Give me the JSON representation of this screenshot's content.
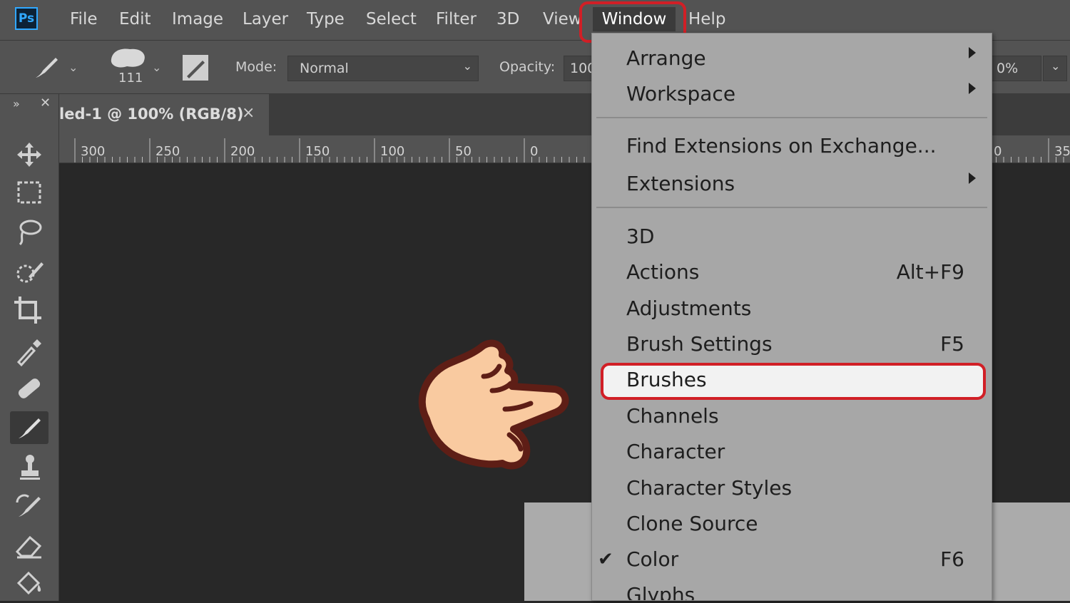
{
  "app": {
    "logo_text": "Ps"
  },
  "menubar": {
    "items": [
      "File",
      "Edit",
      "Image",
      "Layer",
      "Type",
      "Select",
      "Filter",
      "3D",
      "View",
      "Window",
      "Help"
    ]
  },
  "options": {
    "brush_size": "111",
    "mode_label": "Mode:",
    "mode_value": "Normal",
    "opacity_label": "Opacity:",
    "opacity_value": "100",
    "flow_value": "0%"
  },
  "document": {
    "tab_title": "led-1 @ 100% (RGB/8)",
    "tab_close": "×"
  },
  "ruler": {
    "labels": [
      "300",
      "250",
      "200",
      "150",
      "100",
      "50",
      "0",
      "0",
      "35"
    ]
  },
  "window_menu": {
    "items": [
      {
        "label": "Arrange",
        "shortcut": "",
        "submenu": true
      },
      {
        "label": "Workspace",
        "shortcut": "",
        "submenu": true
      },
      {
        "label": "Find Extensions on Exchange...",
        "shortcut": "",
        "submenu": false
      },
      {
        "label": "Extensions",
        "shortcut": "",
        "submenu": true
      },
      {
        "label": "3D",
        "shortcut": ""
      },
      {
        "label": "Actions",
        "shortcut": "Alt+F9"
      },
      {
        "label": "Adjustments",
        "shortcut": ""
      },
      {
        "label": "Brush Settings",
        "shortcut": "F5"
      },
      {
        "label": "Brushes",
        "shortcut": "",
        "highlighted": true
      },
      {
        "label": "Channels",
        "shortcut": ""
      },
      {
        "label": "Character",
        "shortcut": ""
      },
      {
        "label": "Character Styles",
        "shortcut": ""
      },
      {
        "label": "Clone Source",
        "shortcut": ""
      },
      {
        "label": "Color",
        "shortcut": "F6",
        "checked": true
      },
      {
        "label": "Glyphs",
        "shortcut": ""
      }
    ]
  },
  "colors": {
    "accent_red": "#d11f26",
    "menu_bg": "#a7a7a7",
    "highlight_bg": "#f2f2f2",
    "ps_blue": "#31a8ff"
  },
  "icons": [
    "ps-logo",
    "brush-icon",
    "move-icon",
    "marquee-icon",
    "lasso-icon",
    "quick-select-icon",
    "crop-icon",
    "eyedropper-icon",
    "healing-icon",
    "clone-stamp-icon",
    "history-brush-icon",
    "eraser-icon",
    "paint-bucket-icon",
    "pointing-hand-icon",
    "checkmark-icon"
  ]
}
